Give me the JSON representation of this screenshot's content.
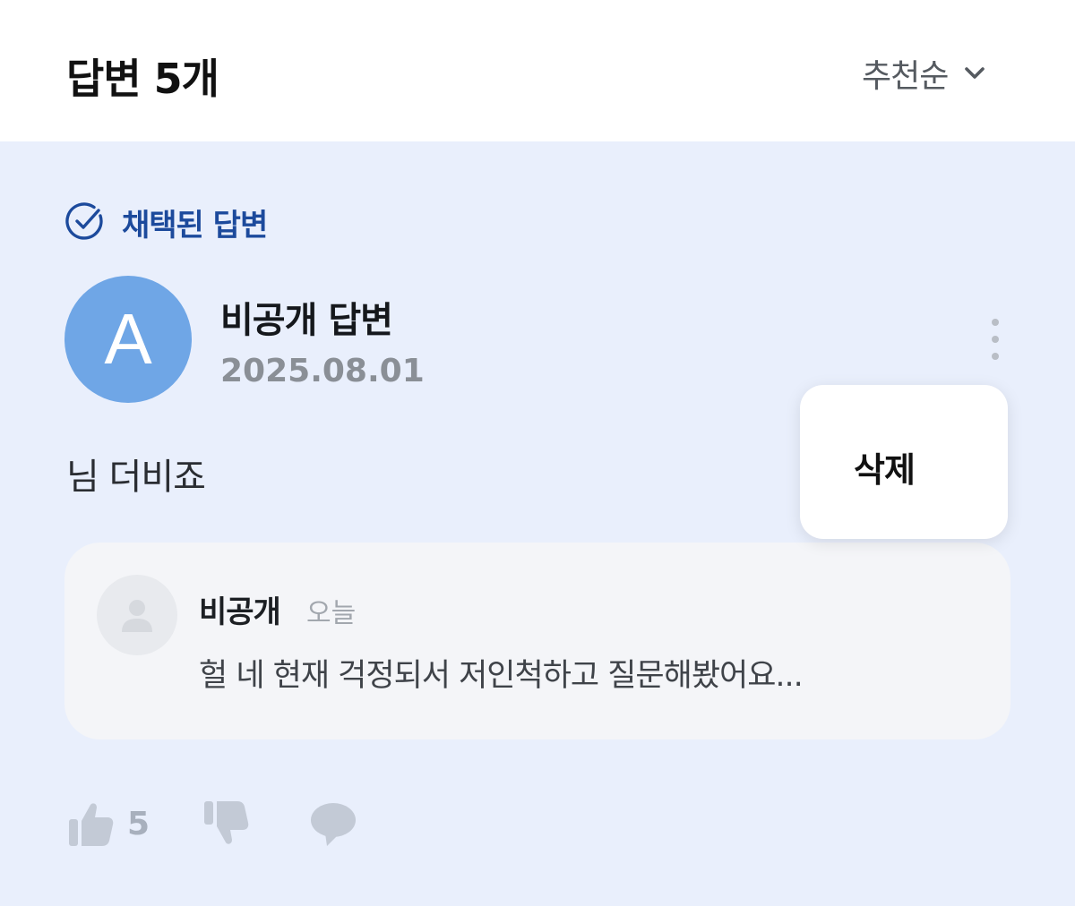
{
  "header": {
    "title": "답변 5개",
    "sort_label": "추천순",
    "sort_icon": "chevron-down-icon"
  },
  "answer": {
    "badge_label": "채택된 답변",
    "badge_icon": "check-circle-icon",
    "avatar_letter": "A",
    "author": "비공개 답변",
    "date": "2025.08.01",
    "body": "님 더비죠",
    "menu_icon": "more-vertical-icon",
    "menu": {
      "delete_label": "삭제"
    },
    "comment": {
      "author": "비공개",
      "time": "오늘",
      "text": "헐 네 현재 걱정되서 저인척하고 질문해봤어요..."
    },
    "actions": {
      "like_icon": "thumbs-up-icon",
      "like_count": "5",
      "dislike_icon": "thumbs-down-icon",
      "reply_icon": "speech-bubble-icon"
    }
  },
  "colors": {
    "accent": "#1c4a9c",
    "panel_bg": "#e9effc",
    "avatar_bg": "#6fa6e6"
  }
}
